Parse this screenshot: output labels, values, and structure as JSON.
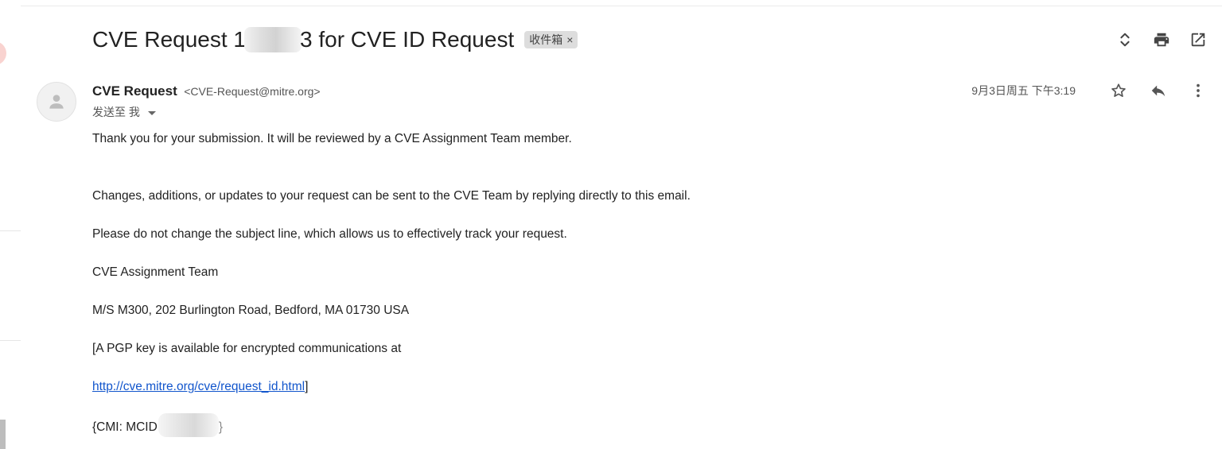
{
  "email": {
    "subject_prefix": "CVE Request 1",
    "subject_suffix": "3 for CVE ID Request",
    "label": "收件箱",
    "label_remove": "×",
    "sender_name": "CVE Request",
    "sender_email": "<CVE-Request@mitre.org>",
    "send_to": "发送至 我",
    "date": "9月3日周五 下午3:19"
  },
  "body": {
    "line1": "Thank you for your submission. It will be reviewed by a CVE Assignment Team member.",
    "line2": "Changes, additions, or updates to your request can be sent to the CVE Team by replying directly to this email.",
    "line3": "Please do not change the subject line, which allows us to effectively track your request.",
    "line4": "CVE Assignment Team",
    "line5": "M/S M300, 202 Burlington Road, Bedford, MA 01730 USA",
    "line6": "[A PGP key is available for encrypted communications at",
    "link": "http://cve.mitre.org/cve/request_id.html",
    "link_suffix": "]",
    "line8_prefix": "{CMI: MCID",
    "line8_suffix": "}"
  },
  "icons": {
    "top": [
      "expand-collapse-icon",
      "print-icon",
      "open-new-window-icon"
    ],
    "message": [
      "star-icon",
      "reply-icon",
      "more-vert-icon"
    ]
  },
  "colors": {
    "link": "#1155cc",
    "chip_bg": "#dddddd",
    "text": "#222222"
  }
}
